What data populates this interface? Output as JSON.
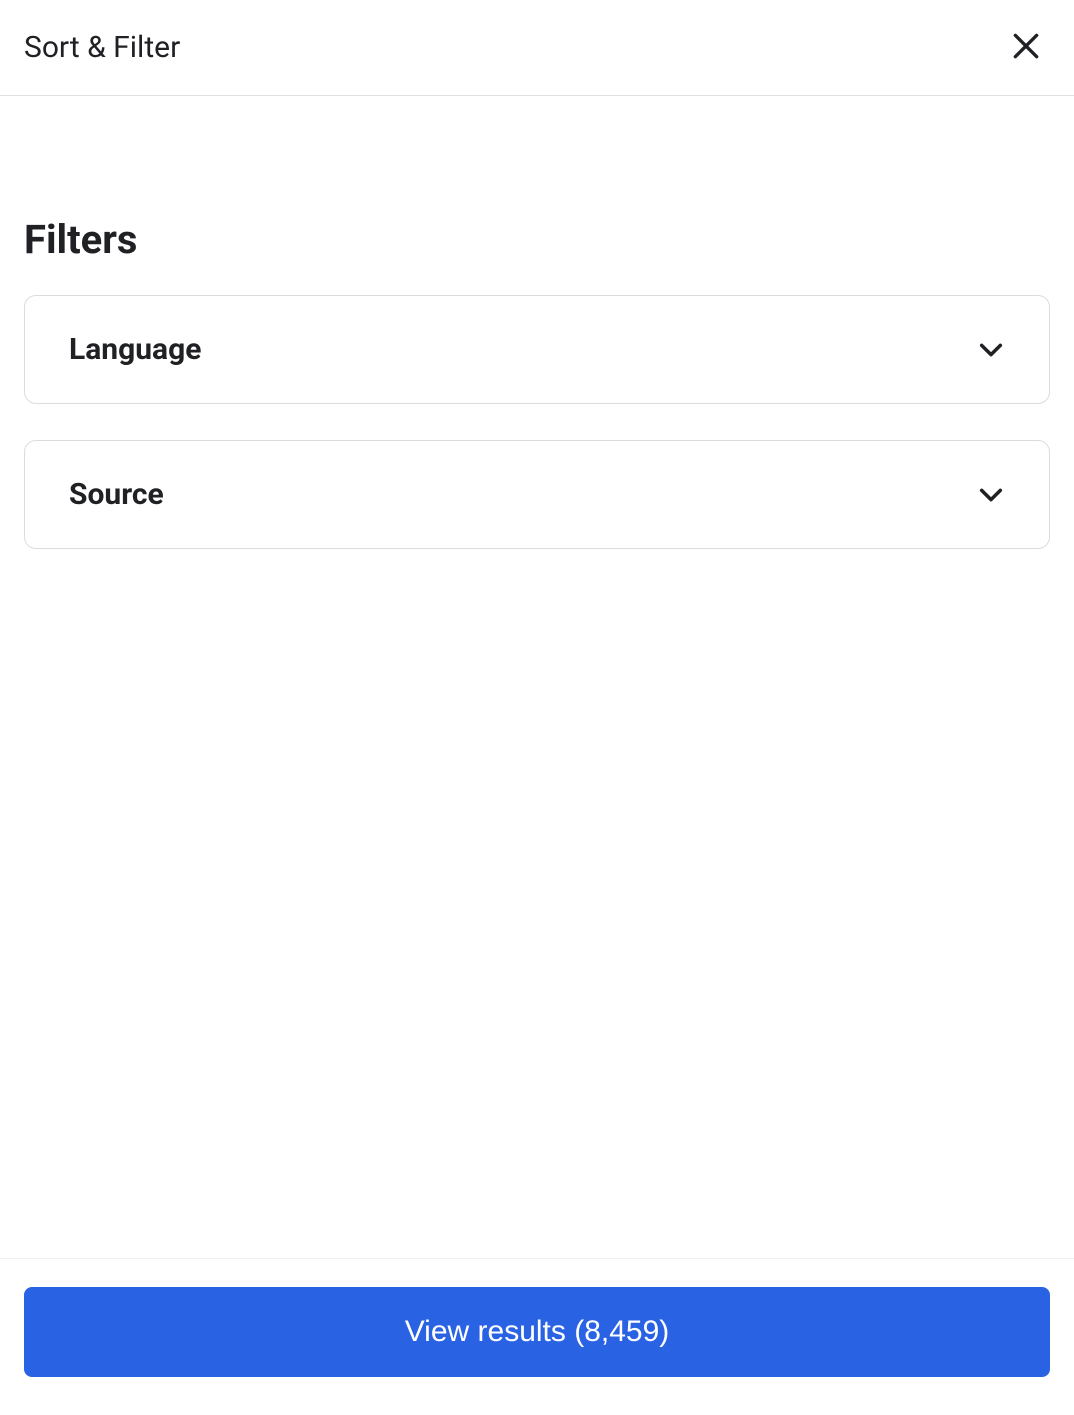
{
  "header": {
    "title": "Sort & Filter"
  },
  "section": {
    "title": "Filters"
  },
  "filters": [
    {
      "label": "Language"
    },
    {
      "label": "Source"
    }
  ],
  "footer": {
    "view_results_label": "View results (8,459)"
  }
}
